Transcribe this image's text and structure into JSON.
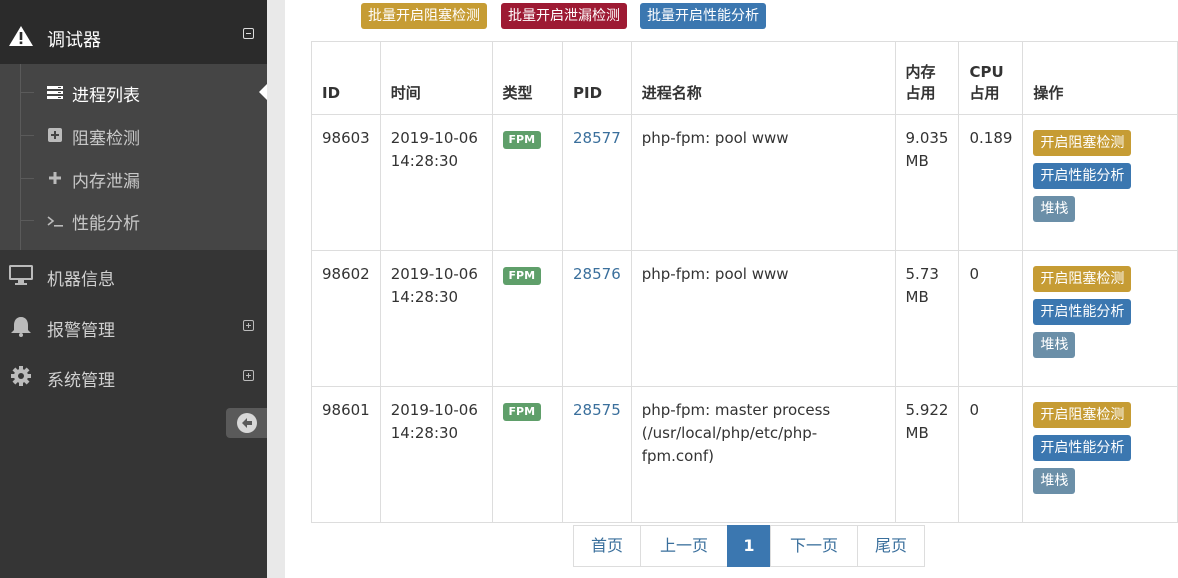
{
  "sidebar": {
    "top": {
      "label": "调试器"
    },
    "sub_items": [
      {
        "label": "进程列表"
      },
      {
        "label": "阻塞检测"
      },
      {
        "label": "内存泄漏"
      },
      {
        "label": "性能分析"
      }
    ],
    "main_items": [
      {
        "label": "机器信息"
      },
      {
        "label": "报警管理"
      },
      {
        "label": "系统管理"
      }
    ]
  },
  "toolbar": {
    "batch_block": "批量开启阻塞检测",
    "batch_leak": "批量开启泄漏检测",
    "batch_perf": "批量开启性能分析"
  },
  "table": {
    "headers": {
      "id": "ID",
      "time": "时间",
      "type": "类型",
      "pid": "PID",
      "name": "进程名称",
      "mem_1": "内存",
      "mem_2": "占用",
      "cpu_1": "CPU",
      "cpu_2": "占用",
      "ops": "操作"
    },
    "rows": [
      {
        "id": "98603",
        "date": "2019-10-06",
        "time": "14:28:30",
        "type": "FPM",
        "pid": "28577",
        "name_1": "php-fpm: pool www",
        "name_2": "",
        "mem_1": "9.035",
        "mem_2": "MB",
        "cpu": "0.189",
        "op_block": "开启阻塞检测",
        "op_perf": "开启性能分析",
        "op_stack": "堆栈"
      },
      {
        "id": "98602",
        "date": "2019-10-06",
        "time": "14:28:30",
        "type": "FPM",
        "pid": "28576",
        "name_1": "php-fpm: pool www",
        "name_2": "",
        "mem_1": "5.73",
        "mem_2": "MB",
        "cpu": "0",
        "op_block": "开启阻塞检测",
        "op_perf": "开启性能分析",
        "op_stack": "堆栈"
      },
      {
        "id": "98601",
        "date": "2019-10-06",
        "time": "14:28:30",
        "type": "FPM",
        "pid": "28575",
        "name_1": "php-fpm: master process",
        "name_2": "(/usr/local/php/etc/php-fpm.conf)",
        "mem_1": "5.922",
        "mem_2": "MB",
        "cpu": "0",
        "op_block": "开启阻塞检测",
        "op_perf": "开启性能分析",
        "op_stack": "堆栈"
      }
    ]
  },
  "pagination": {
    "first": "首页",
    "prev": "上一页",
    "current": "1",
    "next": "下一页",
    "last": "尾页"
  },
  "colors": {
    "warning": "#c69c34",
    "danger": "#9d1a33",
    "info": "#3b77b0",
    "stack": "#6b8fa8",
    "fpm_badge": "#5f9f6a"
  }
}
